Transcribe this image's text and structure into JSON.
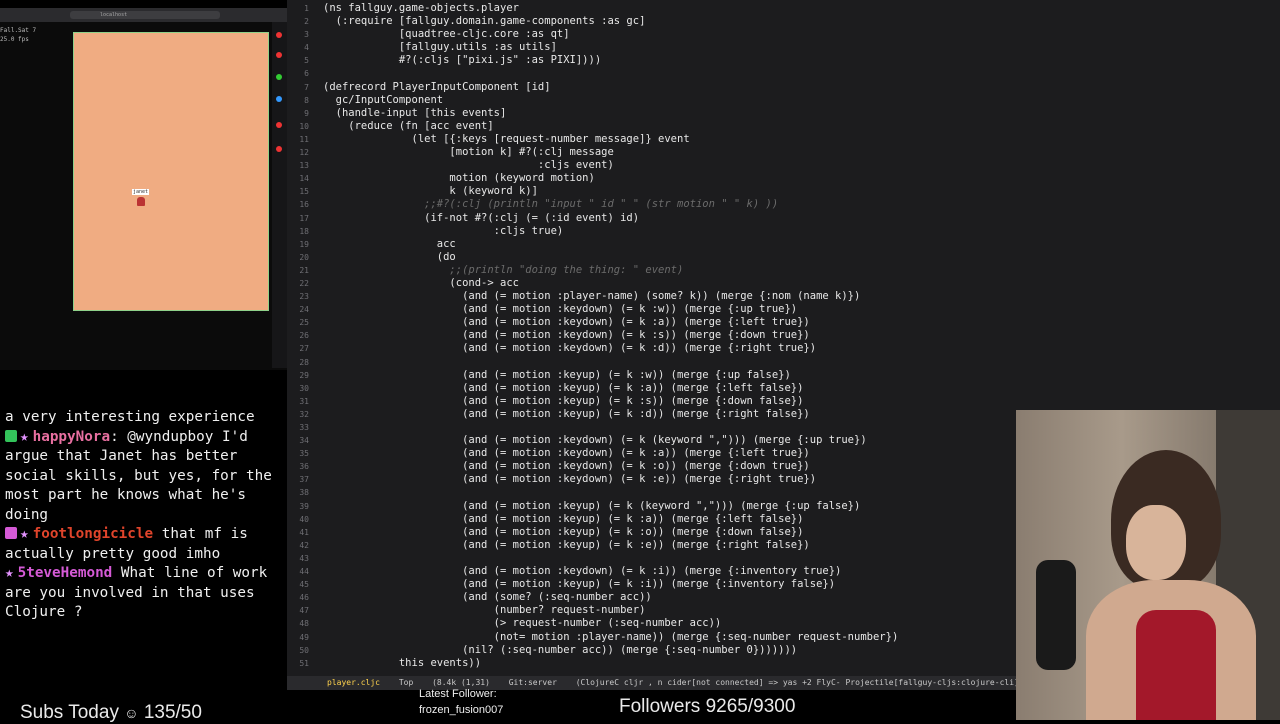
{
  "editor": {
    "lines": [
      {
        "n": "1",
        "t": "(ns fallguy.game-objects.player",
        "c": "src"
      },
      {
        "n": "2",
        "t": "  (:require [fallguy.domain.game-components :as gc]",
        "c": "src"
      },
      {
        "n": "3",
        "t": "            [quadtree-cljc.core :as qt]",
        "c": "src"
      },
      {
        "n": "4",
        "t": "            [fallguy.utils :as utils]",
        "c": "src"
      },
      {
        "n": "5",
        "t": "            #?(:cljs [\"pixi.js\" :as PIXI])))",
        "c": "src"
      },
      {
        "n": "6",
        "t": "",
        "c": "src"
      },
      {
        "n": "7",
        "t": "(defrecord PlayerInputComponent [id]",
        "c": "src"
      },
      {
        "n": "8",
        "t": "  gc/InputComponent",
        "c": "src"
      },
      {
        "n": "9",
        "t": "  (handle-input [this events]",
        "c": "src"
      },
      {
        "n": "10",
        "t": "    (reduce (fn [acc event]",
        "c": "src"
      },
      {
        "n": "11",
        "t": "              (let [{:keys [request-number message]} event",
        "c": "src"
      },
      {
        "n": "12",
        "t": "                    [motion k] #?(:clj message",
        "c": "src"
      },
      {
        "n": "13",
        "t": "                                  :cljs event)",
        "c": "src"
      },
      {
        "n": "14",
        "t": "                    motion (keyword motion)",
        "c": "src"
      },
      {
        "n": "15",
        "t": "                    k (keyword k)]",
        "c": "src"
      },
      {
        "n": "16",
        "t": "                ;;#?(:clj (println \"input \" id \" \" (str motion \" \" k) ))",
        "c": "cm"
      },
      {
        "n": "17",
        "t": "                (if-not #?(:clj (= (:id event) id)",
        "c": "src"
      },
      {
        "n": "18",
        "t": "                           :cljs true)",
        "c": "src"
      },
      {
        "n": "19",
        "t": "                  acc",
        "c": "src"
      },
      {
        "n": "20",
        "t": "                  (do",
        "c": "src"
      },
      {
        "n": "21",
        "t": "                    ;;(println \"doing the thing: \" event)",
        "c": "cm"
      },
      {
        "n": "22",
        "t": "                    (cond-> acc",
        "c": "src"
      },
      {
        "n": "23",
        "t": "                      (and (= motion :player-name) (some? k)) (merge {:nom (name k)})",
        "c": "src"
      },
      {
        "n": "24",
        "t": "                      (and (= motion :keydown) (= k :w)) (merge {:up true})",
        "c": "src"
      },
      {
        "n": "25",
        "t": "                      (and (= motion :keydown) (= k :a)) (merge {:left true})",
        "c": "src"
      },
      {
        "n": "26",
        "t": "                      (and (= motion :keydown) (= k :s)) (merge {:down true})",
        "c": "src"
      },
      {
        "n": "27",
        "t": "                      (and (= motion :keydown) (= k :d)) (merge {:right true})",
        "c": "src"
      },
      {
        "n": "28",
        "t": "",
        "c": "src"
      },
      {
        "n": "29",
        "t": "                      (and (= motion :keyup) (= k :w)) (merge {:up false})",
        "c": "src"
      },
      {
        "n": "30",
        "t": "                      (and (= motion :keyup) (= k :a)) (merge {:left false})",
        "c": "src"
      },
      {
        "n": "31",
        "t": "                      (and (= motion :keyup) (= k :s)) (merge {:down false})",
        "c": "src"
      },
      {
        "n": "32",
        "t": "                      (and (= motion :keyup) (= k :d)) (merge {:right false})",
        "c": "src"
      },
      {
        "n": "33",
        "t": "",
        "c": "src"
      },
      {
        "n": "34",
        "t": "                      (and (= motion :keydown) (= k (keyword \",\"))) (merge {:up true})",
        "c": "src"
      },
      {
        "n": "35",
        "t": "                      (and (= motion :keydown) (= k :a)) (merge {:left true})",
        "c": "src"
      },
      {
        "n": "36",
        "t": "                      (and (= motion :keydown) (= k :o)) (merge {:down true})",
        "c": "src"
      },
      {
        "n": "37",
        "t": "                      (and (= motion :keydown) (= k :e)) (merge {:right true})",
        "c": "src"
      },
      {
        "n": "38",
        "t": "",
        "c": "src"
      },
      {
        "n": "39",
        "t": "                      (and (= motion :keyup) (= k (keyword \",\"))) (merge {:up false})",
        "c": "src"
      },
      {
        "n": "40",
        "t": "                      (and (= motion :keyup) (= k :a)) (merge {:left false})",
        "c": "src"
      },
      {
        "n": "41",
        "t": "                      (and (= motion :keyup) (= k :o)) (merge {:down false})",
        "c": "src"
      },
      {
        "n": "42",
        "t": "                      (and (= motion :keyup) (= k :e)) (merge {:right false})",
        "c": "src"
      },
      {
        "n": "43",
        "t": "",
        "c": "src"
      },
      {
        "n": "44",
        "t": "                      (and (= motion :keydown) (= k :i)) (merge {:inventory true})",
        "c": "src"
      },
      {
        "n": "45",
        "t": "                      (and (= motion :keyup) (= k :i)) (merge {:inventory false})",
        "c": "src"
      },
      {
        "n": "46",
        "t": "                      (and (some? (:seq-number acc))",
        "c": "src"
      },
      {
        "n": "47",
        "t": "                           (number? request-number)",
        "c": "src"
      },
      {
        "n": "48",
        "t": "                           (> request-number (:seq-number acc))",
        "c": "src"
      },
      {
        "n": "49",
        "t": "                           (not= motion :player-name)) (merge {:seq-number request-number})",
        "c": "src"
      },
      {
        "n": "50",
        "t": "                      (nil? (:seq-number acc)) (merge {:seq-number 0}))))))",
        "c": "src"
      },
      {
        "n": "51",
        "t": "            this events))",
        "c": "src"
      }
    ]
  },
  "statusbar": {
    "file": "player.cljc",
    "pos": "Top",
    "size": "(8.4k (1,31)",
    "branch": "Git:server",
    "mode": "(ClojureC cljr , n cider[not connected] => yas +2 FlyC- Projectile[fallguy-cljs:clojure-cli] Pre"
  },
  "browser": {
    "url": "localhost",
    "player_name": "janet",
    "devtools": [
      "Fall.Sat 7",
      "25.0 fps"
    ]
  },
  "chat": {
    "messages": [
      {
        "user": "",
        "text": "a very interesting experience"
      },
      {
        "user": "happyNora",
        "user_color": "#e86fa0",
        "text": ": @wyndupboy I'd argue that Janet has better social skills, but yes, for the most part he knows what he's doing"
      },
      {
        "user": "footlongicicle",
        "user_color": "#e0442b",
        "text": " that mf is actually pretty good imho"
      },
      {
        "user": "5teveHemond",
        "user_color": "#d55ad6",
        "text": " What line of work are you involved in that uses Clojure ?"
      }
    ]
  },
  "overlay": {
    "subs_label": "Subs Today",
    "subs_value": "135/50",
    "latest_follower_label": "Latest Follower:",
    "latest_follower_name": "frozen_fusion007",
    "followers_label": "Followers",
    "followers_value": "9265/9300"
  },
  "colors": {
    "editor_bg": "#1c1c1e",
    "game_bg": "#f0ac82",
    "keyword": "#d0a8ff"
  }
}
